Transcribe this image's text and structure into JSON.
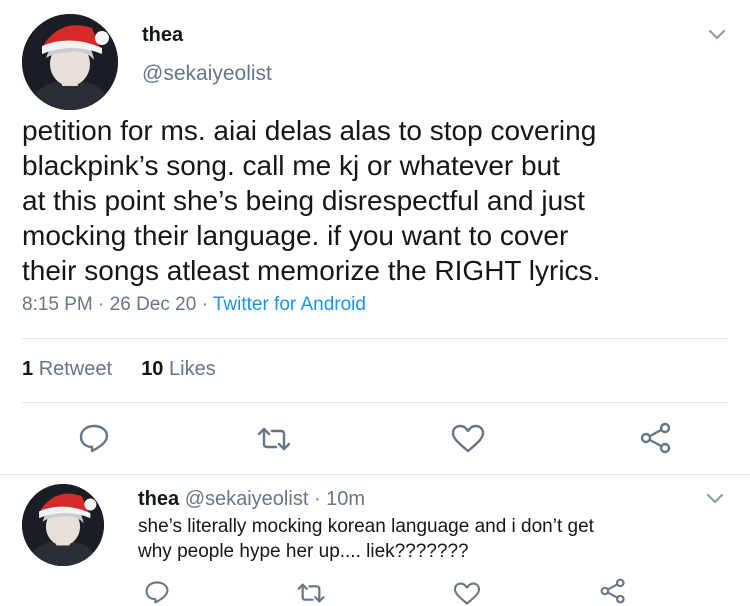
{
  "tweet": {
    "author": {
      "name": "thea",
      "handle": "@sekaiyeolist"
    },
    "text_lines": [
      "petition for ms. aiai delas alas to stop covering",
      "blackpink’s song. call me kj or whatever but",
      "at this point she’s being disrespectful and just",
      "mocking their language. if you want to cover",
      "their songs atleast memorize the RIGHT lyrics."
    ],
    "time": "8:15 PM",
    "date": "26 Dec 20",
    "separator": "·",
    "source": "Twitter for Android",
    "retweets": {
      "count": "1",
      "label": "Retweet"
    },
    "likes": {
      "count": "10",
      "label": "Likes"
    }
  },
  "reply": {
    "author": {
      "name": "thea",
      "handle": "@sekaiyeolist"
    },
    "separator": "·",
    "time": "10m",
    "text_lines": [
      "she’s literally mocking korean language and i don’t get",
      "why people hype her up.... liek???????"
    ]
  },
  "icons": {
    "menu": "chevron-down-icon",
    "reply": "reply-icon",
    "retweet": "retweet-icon",
    "like": "heart-icon",
    "share": "share-icon"
  },
  "colors": {
    "text": "#14171a",
    "muted": "#657786",
    "link": "#1b95e0",
    "divider": "#e1e8ed",
    "santa_hat": "#d42a2a"
  }
}
